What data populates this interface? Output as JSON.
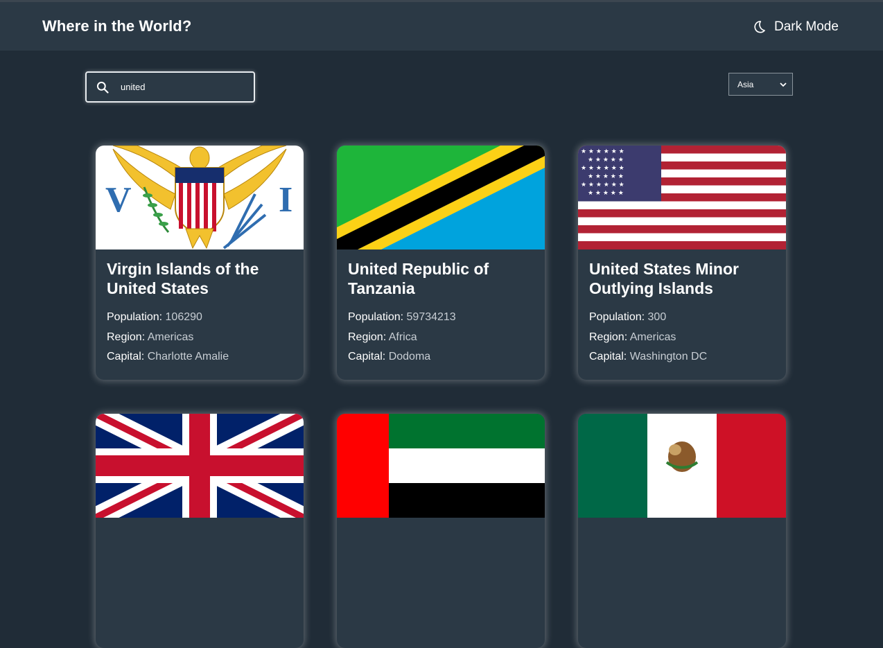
{
  "header": {
    "title": "Where in the World?",
    "mode_toggle_label": "Dark Mode",
    "mode_icon": "moon-icon"
  },
  "search": {
    "value": "united",
    "icon": "search-icon"
  },
  "filter": {
    "selected": "Asia"
  },
  "labels": {
    "population": "Population:",
    "region": "Region:",
    "capital": "Capital:"
  },
  "countries": [
    {
      "name": "Virgin Islands of the United States",
      "population": "106290",
      "region": "Americas",
      "capital": "Charlotte Amalie",
      "flag": "us-virgin-islands-flag"
    },
    {
      "name": "United Republic of Tanzania",
      "population": "59734213",
      "region": "Africa",
      "capital": "Dodoma",
      "flag": "tanzania-flag"
    },
    {
      "name": "United States Minor Outlying Islands",
      "population": "300",
      "region": "Americas",
      "capital": "Washington DC",
      "flag": "us-flag"
    },
    {
      "name": "",
      "flag": "united-kingdom-flag"
    },
    {
      "name": "",
      "flag": "uae-flag"
    },
    {
      "name": "",
      "flag": "mexico-flag"
    }
  ],
  "colors": {
    "background": "#202c37",
    "elements": "#2b3945",
    "text": "#ffffff"
  }
}
